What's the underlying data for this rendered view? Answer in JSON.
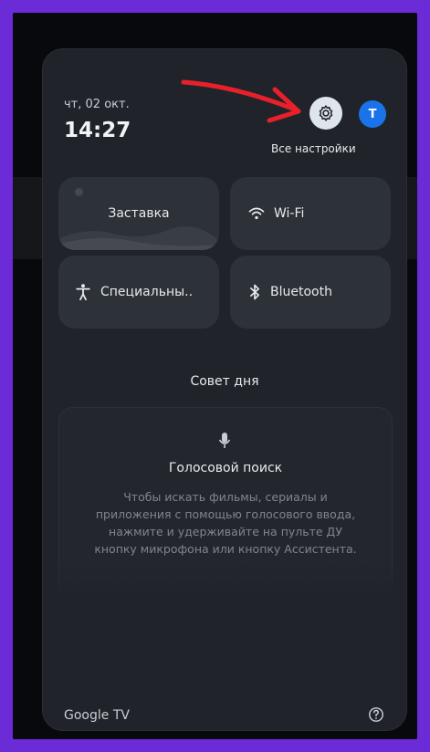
{
  "header": {
    "date": "чт, 02 окт.",
    "time": "14:27",
    "settings_label": "Все настройки",
    "avatar_initial": "Т"
  },
  "tiles": {
    "screensaver": "Заставка",
    "wifi": "Wi-Fi",
    "accessibility": "Специальны..",
    "bluetooth": "Bluetooth"
  },
  "tip": {
    "section_title": "Совет дня",
    "heading": "Голосовой поиск",
    "body": "Чтобы искать фильмы, сериалы и приложения с помощью голосового ввода, нажмите и удерживайте на пульте ДУ кнопку микрофона или кнопку Ассистента."
  },
  "footer": {
    "brand": "Google TV"
  },
  "icons": {
    "settings": "gear-icon",
    "wifi": "wifi-icon",
    "accessibility": "accessibility-icon",
    "bluetooth": "bluetooth-icon",
    "mic": "mic-icon",
    "help": "help-icon",
    "annotation": "red-arrow-icon"
  },
  "colors": {
    "frame": "#6b2bd6",
    "panel": "#20242a",
    "tile": "#2d3138",
    "avatar": "#1a73e8",
    "arrow": "#e8202a"
  }
}
